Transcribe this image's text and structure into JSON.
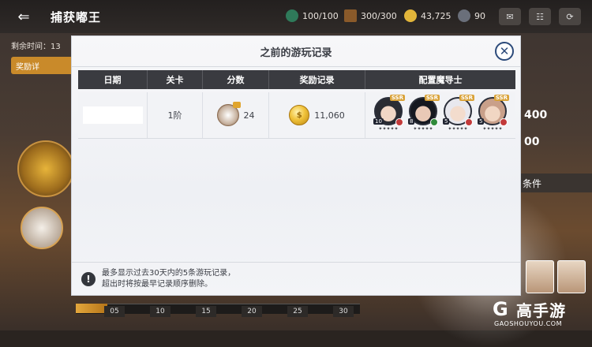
{
  "topbar": {
    "title": "捕获嘟王",
    "resources": [
      {
        "icon": "stamina-icon",
        "value": "100/100"
      },
      {
        "icon": "ticket-icon",
        "value": "300/300"
      },
      {
        "icon": "gold-coin-icon",
        "value": "43,725"
      },
      {
        "icon": "gem-icon",
        "value": "90"
      }
    ]
  },
  "left_panel": {
    "remaining_time": "剩余时间：13",
    "reward_detail_btn": "奖励详"
  },
  "right_panel": {
    "num1": "400",
    "num2": "00",
    "condition_btn": "条件"
  },
  "stage_ticks": [
    "05",
    "10",
    "15",
    "20",
    "25",
    "30"
  ],
  "modal": {
    "title": "之前的游玩记录",
    "close_label": "✕",
    "columns": [
      "日期",
      "关卡",
      "分数",
      "奖励记录",
      "配置魔导士"
    ],
    "rows": [
      {
        "date": "",
        "stage": "1阶",
        "score": "24",
        "reward": "11,060",
        "mages": [
          {
            "level": "10",
            "rank": "SSR",
            "elem_color": "#c23a3a",
            "hair": "#2a2c33",
            "skin": "#f1d7c6"
          },
          {
            "level": "8",
            "rank": "SSR",
            "elem_color": "#2f8a3a",
            "hair": "#151820",
            "skin": "#e9c9b6"
          },
          {
            "level": "5",
            "rank": "SSR",
            "elem_color": "#c23a3a",
            "hair": "#e8e8ee",
            "skin": "#f3dccd"
          },
          {
            "level": "5",
            "rank": "SSR",
            "elem_color": "#c23a3a",
            "hair": "#c9a08a",
            "skin": "#f1d6c3"
          }
        ],
        "stars": "✦✦✦✦✦"
      }
    ],
    "notice_line1": "最多显示过去30天内的5条游玩记录，",
    "notice_line2": "超出时将按最早记录顺序删除。"
  },
  "watermark": {
    "logo": "G",
    "name": "高手游",
    "url": "GAOSHOUYOU.COM"
  }
}
